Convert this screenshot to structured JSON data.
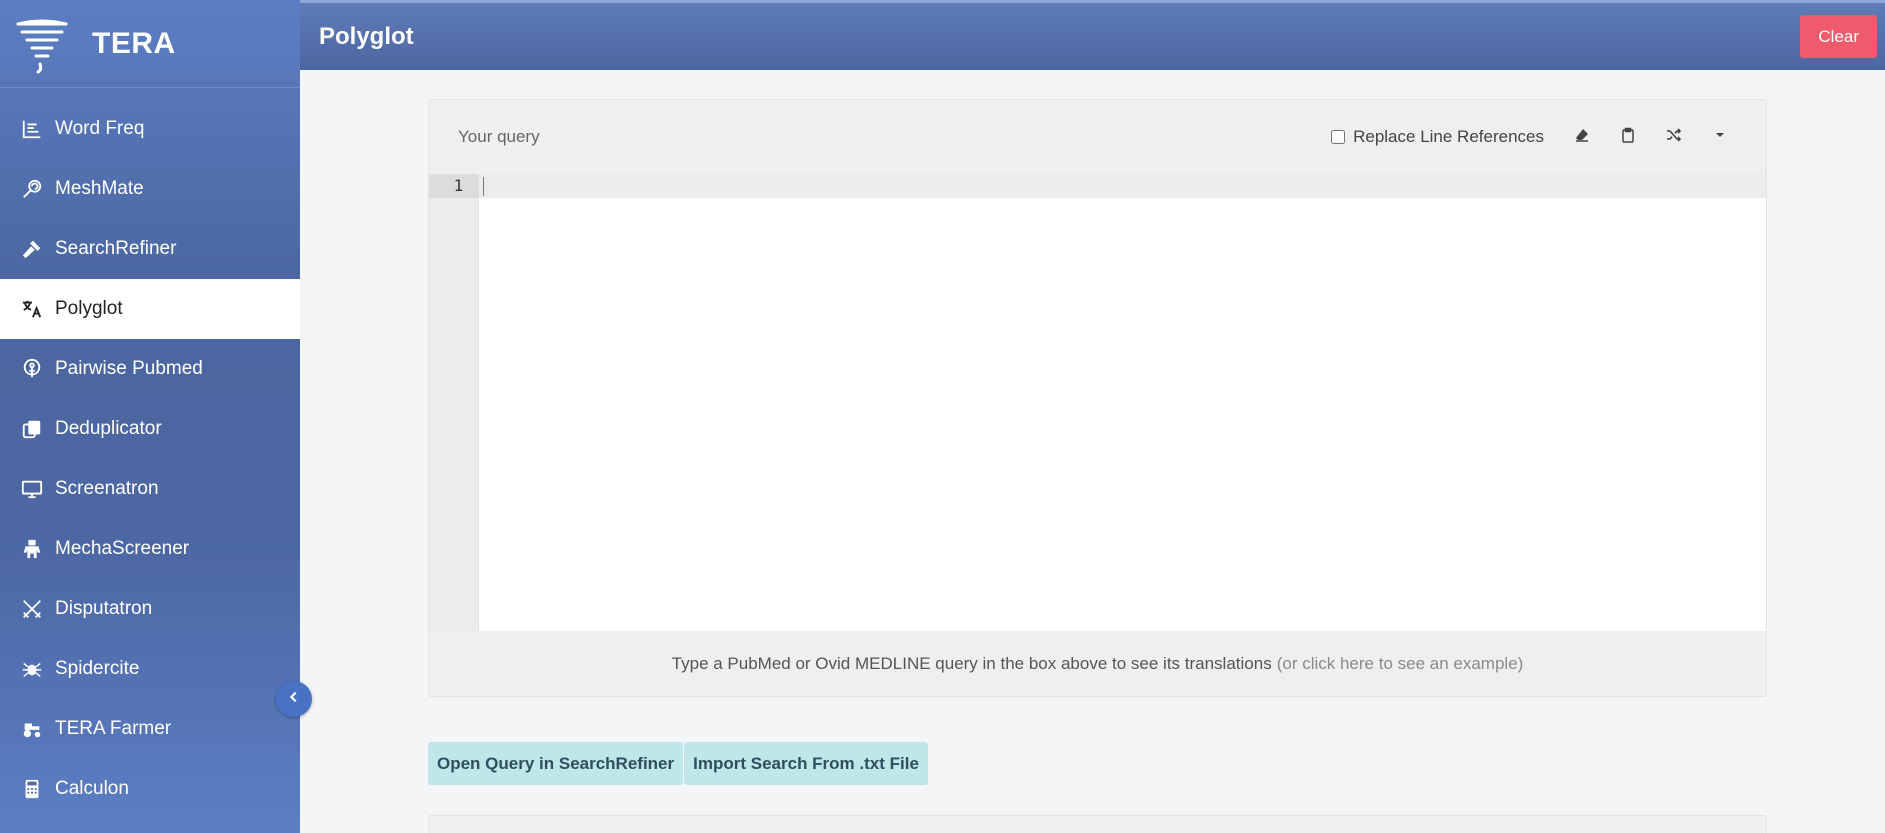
{
  "brand": {
    "name": "TERA"
  },
  "nav": {
    "items": [
      {
        "label": "Word Freq",
        "icon": "bar-chart-icon"
      },
      {
        "label": "MeshMate",
        "icon": "lollipop-icon"
      },
      {
        "label": "SearchRefiner",
        "icon": "hammer-icon"
      },
      {
        "label": "Polyglot",
        "icon": "translate-icon",
        "active": true
      },
      {
        "label": "Pairwise Pubmed",
        "icon": "person-icon"
      },
      {
        "label": "Deduplicator",
        "icon": "copy-icon"
      },
      {
        "label": "Screenatron",
        "icon": "monitor-icon"
      },
      {
        "label": "MechaScreener",
        "icon": "robot-icon"
      },
      {
        "label": "Disputatron",
        "icon": "crossed-swords-icon"
      },
      {
        "label": "Spidercite",
        "icon": "spider-icon"
      },
      {
        "label": "TERA Farmer",
        "icon": "tractor-icon"
      },
      {
        "label": "Calculon",
        "icon": "calculator-icon"
      }
    ]
  },
  "header": {
    "title": "Polyglot",
    "clear_label": "Clear"
  },
  "query": {
    "title": "Your query",
    "replace_line_refs_label": "Replace Line References",
    "replace_line_refs_checked": false,
    "line_number": "1",
    "value": "",
    "footer_text": "Type a PubMed or Ovid MEDLINE query in the box above to see its translations",
    "example_link": "(or click here to see an example)"
  },
  "actions": {
    "open_in_searchrefiner": "Open Query in SearchRefiner",
    "import_txt": "Import Search From .txt File"
  },
  "colors": {
    "sidebar": "#4c67a3",
    "topbar": "#4c66a0",
    "clear_button": "#ef5a6c",
    "action_button": "#bfe7ea"
  }
}
